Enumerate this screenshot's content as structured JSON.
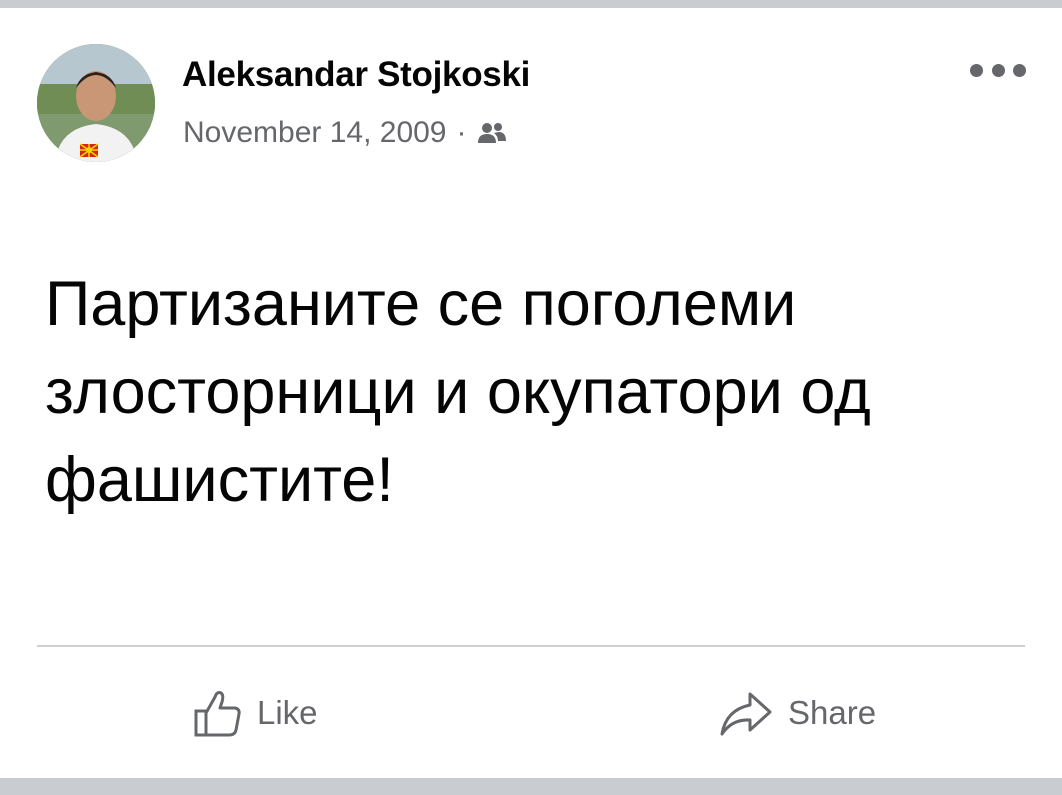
{
  "post": {
    "author_name": "Aleksandar Stojkoski",
    "date": "November 14, 2009",
    "separator": "·",
    "audience_icon": "friends-icon",
    "more_icon": "more-options-icon",
    "text_lines": [
      "Партизаните се поголеми",
      "злосторници и окупатори од",
      "фашистите!"
    ]
  },
  "actions": {
    "like_label": "Like",
    "like_icon": "thumbs-up-icon",
    "share_label": "Share",
    "share_icon": "share-arrow-icon"
  },
  "colors": {
    "background": "#c9ccd1",
    "card": "#ffffff",
    "primary_text": "#050505",
    "secondary_text": "#65676b",
    "divider": "#ced0d4"
  }
}
